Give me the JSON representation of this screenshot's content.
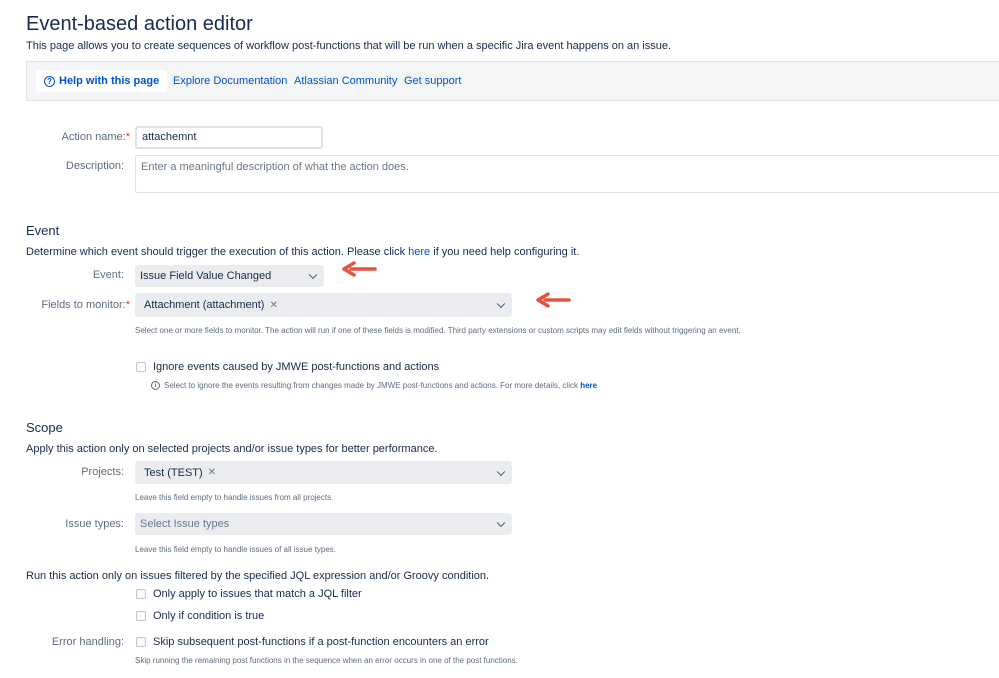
{
  "page": {
    "title": "Event-based action editor",
    "subtitle": "This page allows you to create sequences of workflow post-functions that will be run when a specific Jira event happens on an issue."
  },
  "help_bar": {
    "help_label": "Help with this page",
    "links": [
      "Explore Documentation",
      "Atlassian Community",
      "Get support"
    ]
  },
  "action": {
    "name_label": "Action name:",
    "name_value": "attachemnt",
    "description_label": "Description:",
    "description_placeholder": "Enter a meaningful description of what the action does."
  },
  "event": {
    "heading": "Event",
    "intro_before": "Determine which event should trigger the execution of this action. Please click ",
    "intro_link": "here",
    "intro_after": " if you need help configuring it.",
    "event_label": "Event:",
    "event_value": "Issue Field Value Changed",
    "fields_label": "Fields to monitor:",
    "fields_chip": "Attachment (attachment)",
    "fields_hint": "Select one or more fields to monitor. The action will run if one of these fields is modified. Third party extensions or custom scripts may edit fields without triggering an event.",
    "ignore_label": "Ignore events caused by JMWE post-functions and actions",
    "ignore_hint": "Select to ignore the events resulting from changes made by JMWE post-functions and actions. For more details, click ",
    "ignore_hint_link": "here"
  },
  "scope": {
    "heading": "Scope",
    "intro": "Apply this action only on selected projects and/or issue types for better performance.",
    "projects_label": "Projects:",
    "projects_chip": "Test (TEST)",
    "projects_hint": "Leave this field empty to handle issues from all projects.",
    "issue_types_label": "Issue types:",
    "issue_types_placeholder": "Select Issue types",
    "issue_types_hint": "Leave this field empty to handle issues of all issue types.",
    "jql_intro": "Run this action only on issues filtered by the specified JQL expression and/or Groovy condition.",
    "jql_checkbox": "Only apply to issues that match a JQL filter",
    "condition_checkbox": "Only if condition is true",
    "error_label": "Error handling:",
    "error_checkbox": "Skip subsequent post-functions if a post-function encounters an error",
    "error_hint": "Skip running the remaining post functions in the sequence when an error occurs in one of the post functions."
  },
  "colors": {
    "link": "#0052cc",
    "required": "#de350b",
    "annotation_arrow": "#e5533d"
  }
}
